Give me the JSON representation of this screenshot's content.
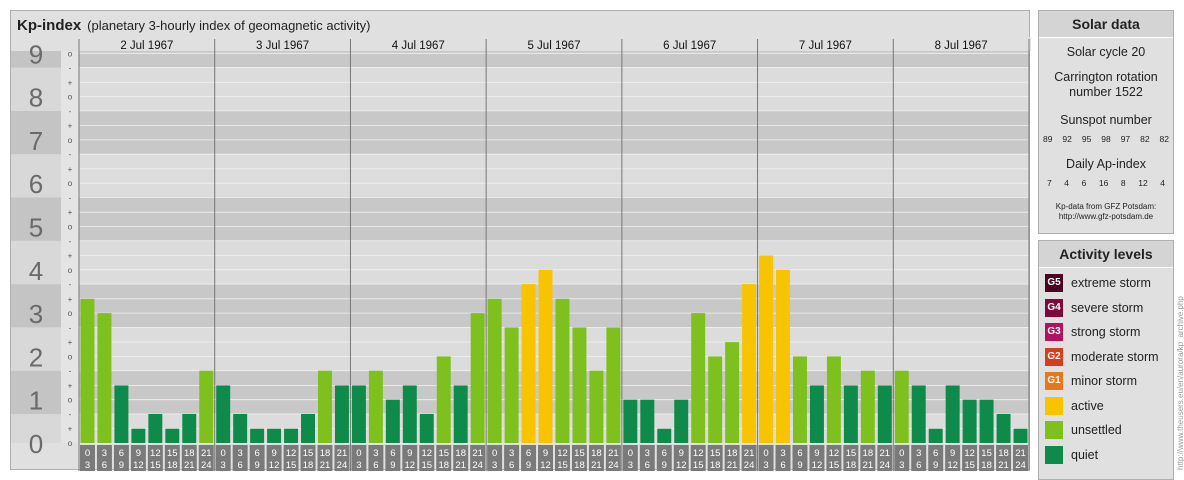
{
  "chart_data": {
    "type": "bar",
    "title": "Kp-index",
    "subtitle": "(planetary 3-hourly index of geomagnetic activity)",
    "days": [
      "2 Jul 1967",
      "3 Jul 1967",
      "4 Jul 1967",
      "5 Jul 1967",
      "6 Jul 1967",
      "7 Jul 1967",
      "8 Jul 1967"
    ],
    "interval_starts": [
      "0",
      "3",
      "6",
      "9",
      "12",
      "15",
      "18",
      "21"
    ],
    "interval_ends": [
      "3",
      "6",
      "9",
      "12",
      "15",
      "18",
      "21",
      "24"
    ],
    "y_ticks": [
      "0",
      "1",
      "2",
      "3",
      "4",
      "5",
      "6",
      "7",
      "8",
      "9"
    ],
    "sub_ticks": [
      "+",
      "o",
      "-"
    ],
    "ylim": [
      0,
      9.33
    ],
    "values": [
      3.33,
      3.0,
      1.33,
      0.33,
      0.67,
      0.33,
      0.67,
      1.67,
      1.33,
      0.67,
      0.33,
      0.33,
      0.33,
      0.67,
      1.67,
      1.33,
      1.33,
      1.67,
      1.0,
      1.33,
      0.67,
      2.0,
      1.33,
      3.0,
      3.33,
      2.67,
      3.67,
      4.0,
      3.33,
      2.67,
      1.67,
      2.67,
      1.0,
      1.0,
      0.33,
      1.0,
      3.0,
      2.0,
      2.33,
      3.67,
      4.33,
      4.0,
      2.0,
      1.33,
      2.0,
      1.33,
      1.67,
      1.33,
      1.67,
      1.33,
      0.33,
      1.33,
      1.0,
      1.0,
      0.67,
      0.33
    ],
    "colors": {
      "quiet": "#0e8a4a",
      "unsettled": "#7ec11f",
      "active": "#f8c400",
      "minor": "#e8771b",
      "moderate": "#d43e1e",
      "strong": "#b0135d",
      "severe": "#7d0a3a",
      "extreme": "#4a0520"
    }
  },
  "solar": {
    "header": "Solar data",
    "cycle": "Solar cycle 20",
    "carrington": "Carrington rotation number 1522",
    "sunspot_label": "Sunspot number",
    "sunspots": [
      "89",
      "92",
      "95",
      "98",
      "97",
      "82",
      "82"
    ],
    "ap_label": "Daily Ap-index",
    "ap": [
      "7",
      "4",
      "6",
      "16",
      "8",
      "12",
      "4"
    ],
    "credit_line1": "Kp-data from GFZ Potsdam:",
    "credit_line2": "http://www.gfz-potsdam.de"
  },
  "activity": {
    "header": "Activity levels",
    "levels": [
      {
        "badge": "G5",
        "label": "extreme storm",
        "color": "#4a0520"
      },
      {
        "badge": "G4",
        "label": "severe storm",
        "color": "#7d0a3a"
      },
      {
        "badge": "G3",
        "label": "strong storm",
        "color": "#b0135d"
      },
      {
        "badge": "G2",
        "label": "moderate storm",
        "color": "#d43e1e"
      },
      {
        "badge": "G1",
        "label": "minor storm",
        "color": "#e8771b"
      },
      {
        "badge": "",
        "label": "active",
        "color": "#f8c400"
      },
      {
        "badge": "",
        "label": "unsettled",
        "color": "#7ec11f"
      },
      {
        "badge": "",
        "label": "quiet",
        "color": "#0e8a4a"
      }
    ]
  },
  "watermark": "http://www.theusers.eu/en/aurora/kp_archive.php"
}
